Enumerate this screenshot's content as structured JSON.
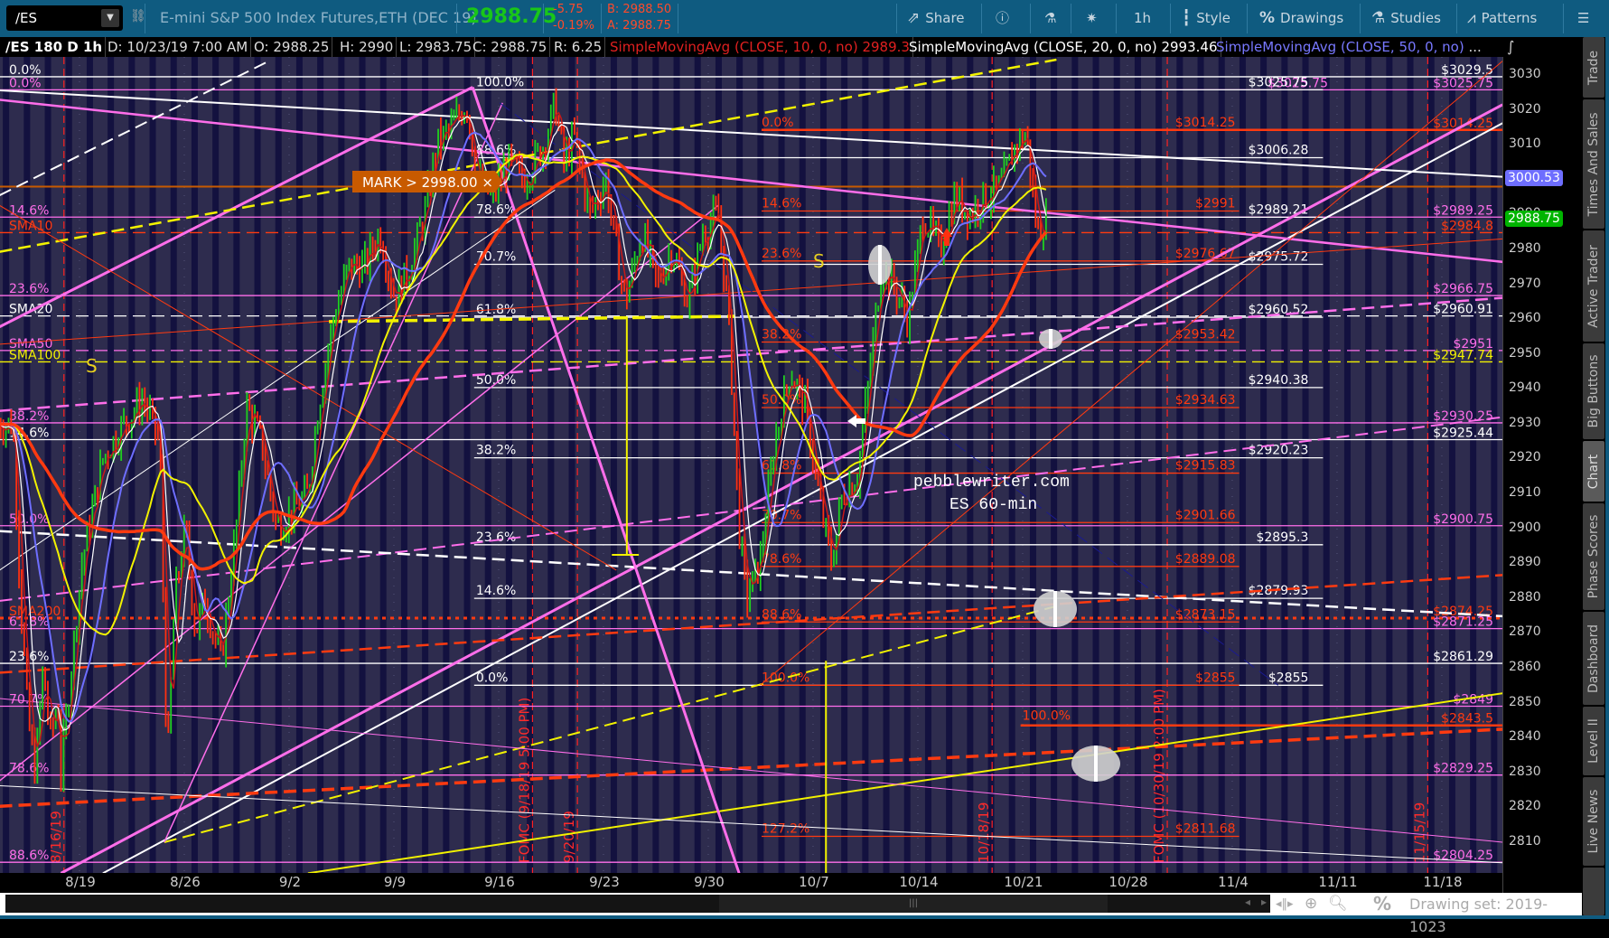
{
  "toolbar": {
    "symbol": "/ES",
    "description": "E-mini S&P 500 Index Futures,ETH (DEC 19)",
    "last_price": "2988.75",
    "net_change": "-5.75",
    "pct_change": "-0.19%",
    "bid": "B: 2988.50",
    "ask": "A: 2988.75",
    "buttons": {
      "share": "Share",
      "timeframe": "1h",
      "style": "Style",
      "drawings": "Drawings",
      "studies": "Studies",
      "patterns": "Patterns"
    },
    "colors": {
      "bg": "#0f5b80",
      "up": "#19c619",
      "down": "#ff4a2a"
    }
  },
  "info_row": {
    "title": "/ES 180 D 1h",
    "date": "D: 10/23/19 7:00 AM",
    "open": "O: 2988.25",
    "high": "H: 2990",
    "low": "L: 2983.75",
    "close": "C: 2988.75",
    "range": "R: 6.25",
    "studies": [
      {
        "label": "SimpleMovingAvg (CLOSE, 10, 0, no)",
        "value": "2989.3",
        "color": "#e02020"
      },
      {
        "label": "SimpleMovingAvg (CLOSE, 20, 0, no)",
        "value": "2993.46",
        "color": "#ffffff"
      },
      {
        "label": "SimpleMovingAvg (CLOSE, 50, 0, no)",
        "value": "...",
        "color": "#7878ff"
      }
    ]
  },
  "chart_data": {
    "type": "candlestick",
    "symbol": "/ES",
    "interval": "1h",
    "ylim": [
      2801,
      3035
    ],
    "y_ticks": [
      3030,
      3020,
      3010,
      3000,
      2990,
      2980,
      2970,
      2960,
      2950,
      2940,
      2930,
      2920,
      2910,
      2900,
      2890,
      2880,
      2870,
      2860,
      2850,
      2840,
      2830,
      2820,
      2810
    ],
    "x_ticks": [
      "8/19",
      "8/26",
      "9/2",
      "9/9",
      "9/16",
      "9/23",
      "9/30",
      "10/7",
      "10/14",
      "10/21",
      "10/28",
      "11/4",
      "11/11",
      "11/18"
    ],
    "x_unit": "days from 8/19 (7 per week)",
    "price_path": [
      [
        -5.5,
        2930
      ],
      [
        -4.5,
        2930
      ],
      [
        -4,
        2880
      ],
      [
        -3.5,
        2845
      ],
      [
        -3,
        2830
      ],
      [
        -2.5,
        2860
      ],
      [
        -2,
        2840
      ],
      [
        -1.5,
        2850
      ],
      [
        -1.3,
        2830
      ],
      [
        0.1,
        2890
      ],
      [
        1.5,
        2920
      ],
      [
        2.9,
        2930
      ],
      [
        4.2,
        2937
      ],
      [
        5.3,
        2925
      ],
      [
        5.8,
        2830
      ],
      [
        6.3,
        2880
      ],
      [
        7,
        2900
      ],
      [
        7.7,
        2870
      ],
      [
        8.3,
        2880
      ],
      [
        9.4,
        2862
      ],
      [
        10.4,
        2900
      ],
      [
        11.1,
        2935
      ],
      [
        12.1,
        2925
      ],
      [
        13.1,
        2900
      ],
      [
        14.2,
        2905
      ],
      [
        15.2,
        2910
      ],
      [
        15.9,
        2935
      ],
      [
        16.9,
        2960
      ],
      [
        17.9,
        2975
      ],
      [
        19,
        2975
      ],
      [
        20,
        2985
      ],
      [
        21,
        2966
      ],
      [
        22,
        2975
      ],
      [
        23,
        2990
      ],
      [
        23.8,
        3010
      ],
      [
        24.8,
        3015
      ],
      [
        25.8,
        3022
      ],
      [
        26.5,
        3000
      ],
      [
        27.5,
        2995
      ],
      [
        28.6,
        3005
      ],
      [
        29.6,
        3000
      ],
      [
        31,
        3010
      ],
      [
        31.7,
        3022
      ],
      [
        32.3,
        3005
      ],
      [
        33,
        3012
      ],
      [
        34,
        2990
      ],
      [
        35.1,
        3000
      ],
      [
        35.8,
        2980
      ],
      [
        36.4,
        2965
      ],
      [
        37.5,
        2985
      ],
      [
        38.5,
        2970
      ],
      [
        39.5,
        2980
      ],
      [
        40.6,
        2965
      ],
      [
        41.6,
        2985
      ],
      [
        42.6,
        2990
      ],
      [
        43.3,
        2960
      ],
      [
        44,
        2900
      ],
      [
        44.5,
        2880
      ],
      [
        45.4,
        2890
      ],
      [
        46.4,
        2925
      ],
      [
        47.4,
        2945
      ],
      [
        48.4,
        2935
      ],
      [
        49.5,
        2905
      ],
      [
        50.2,
        2890
      ],
      [
        50.9,
        2910
      ],
      [
        51.9,
        2915
      ],
      [
        52.6,
        2940
      ],
      [
        53.5,
        2975
      ],
      [
        54.3,
        2970
      ],
      [
        55.3,
        2960
      ],
      [
        56.3,
        2990
      ],
      [
        57.4,
        2980
      ],
      [
        58.4,
        2995
      ],
      [
        59.4,
        2990
      ],
      [
        60.4,
        2995
      ],
      [
        61.5,
        2998
      ],
      [
        62.5,
        3010
      ],
      [
        63.2,
        3013
      ],
      [
        63.9,
        2985
      ],
      [
        64.6,
        2988.75
      ]
    ],
    "moving_averages": [
      {
        "name": "SMA10",
        "color": "#c81818"
      },
      {
        "name": "SMA20",
        "color": "#ffffff"
      },
      {
        "name": "SMA50",
        "color": "#6e6eff"
      },
      {
        "name": "SMA100",
        "color": "#f2f200"
      },
      {
        "name": "SMA200",
        "color": "#ff3a10"
      }
    ],
    "levels_full": [
      {
        "price": 3029.5,
        "color": "#ffffff",
        "style": "solid",
        "left": "0.0%",
        "right": "$3029.5"
      },
      {
        "price": 3025.75,
        "color": "#ff6eea",
        "style": "solid",
        "left": "0.0%",
        "right": "$3025.75"
      },
      {
        "price": 2989.25,
        "color": "#ff6eea",
        "style": "solid",
        "left": "14.6%",
        "right": "$2989.25"
      },
      {
        "price": 2984.8,
        "color": "#ff3a10",
        "style": "dash",
        "left": "SMA10",
        "right": "$2984.8"
      },
      {
        "price": 2966.75,
        "color": "#ff6eea",
        "style": "solid",
        "left": "23.6%",
        "right": "$2966.75"
      },
      {
        "price": 2960.91,
        "color": "#ffffff",
        "style": "dash",
        "left": "SMA20",
        "right": "$2960.91"
      },
      {
        "price": 2951,
        "color": "#ff6eea",
        "style": "dash",
        "left": "SMA50",
        "right": "$2951"
      },
      {
        "price": 2947.74,
        "color": "#f2f200",
        "style": "dash",
        "left": "SMA100",
        "right": "$2947.74"
      },
      {
        "price": 2930.25,
        "color": "#ff6eea",
        "style": "solid",
        "left": "38.2%",
        "right": "$2930.25"
      },
      {
        "price": 2925.44,
        "color": "#ffffff",
        "style": "solid",
        "left": "14.6%",
        "right": "$2925.44"
      },
      {
        "price": 2900.75,
        "color": "#ff6eea",
        "style": "solid",
        "left": "50.0%",
        "right": "$2900.75"
      },
      {
        "price": 2874.25,
        "color": "#ff3a10",
        "style": "dot",
        "left": "SMA200",
        "right": "$2874.25"
      },
      {
        "price": 2871.25,
        "color": "#ff6eea",
        "style": "solid",
        "left": "61.8%",
        "right": "$2871.25"
      },
      {
        "price": 2861.29,
        "color": "#ffffff",
        "style": "solid",
        "left": "23.6%",
        "right": "$2861.29"
      },
      {
        "price": 2849,
        "color": "#ff6eea",
        "style": "solid",
        "left": "70.7%",
        "right": "$2849"
      },
      {
        "price": 2829.25,
        "color": "#ff6eea",
        "style": "solid",
        "left": "78.6%",
        "right": "$2829.25"
      },
      {
        "price": 2804.25,
        "color": "#ff6eea",
        "style": "solid",
        "left": "88.6%",
        "right": "$2804.25"
      }
    ],
    "extra_pink_label": "$3025.75",
    "fib_white": {
      "t_start": 26.3,
      "t_end": 83,
      "color": "#ffffff",
      "levels": [
        {
          "price": 3025.75,
          "pct": "100.0%",
          "value": "$3025.75"
        },
        {
          "price": 3006.28,
          "pct": "88.6%",
          "value": "$3006.28"
        },
        {
          "price": 2989.21,
          "pct": "78.6%",
          "value": "$2989.21"
        },
        {
          "price": 2975.72,
          "pct": "70.7%",
          "value": "$2975.72"
        },
        {
          "price": 2960.52,
          "pct": "61.8%",
          "value": "$2960.52"
        },
        {
          "price": 2940.38,
          "pct": "50.0%",
          "value": "$2940.38"
        },
        {
          "price": 2920.23,
          "pct": "38.2%",
          "value": "$2920.23"
        },
        {
          "price": 2895.3,
          "pct": "23.6%",
          "value": "$2895.3"
        },
        {
          "price": 2879.93,
          "pct": "14.6%",
          "value": "$2879.93"
        },
        {
          "price": 2855,
          "pct": "0.0%",
          "value": "$2855"
        }
      ]
    },
    "fib_red": {
      "t_start": 45.5,
      "t_end": 77.4,
      "color": "#ff3a10",
      "levels": [
        {
          "price": 3014.25,
          "pct": "0.0%",
          "value": "$3014.25",
          "full": true,
          "right": "$3014.25"
        },
        {
          "price": 2991,
          "pct": "14.6%",
          "value": "$2991"
        },
        {
          "price": 2976.67,
          "pct": "23.6%",
          "value": "$2976.67"
        },
        {
          "price": 2953.42,
          "pct": "38.2%",
          "value": "$2953.42"
        },
        {
          "price": 2934.63,
          "pct": "50.0%",
          "value": "$2934.63"
        },
        {
          "price": 2915.83,
          "pct": "61.8%",
          "value": "$2915.83"
        },
        {
          "price": 2901.66,
          "pct": "70.7%",
          "value": "$2901.66"
        },
        {
          "price": 2889.08,
          "pct": "78.6%",
          "value": "$2889.08"
        },
        {
          "price": 2873.15,
          "pct": "88.6%",
          "value": "$2873.15"
        },
        {
          "price": 2855,
          "pct": "100.0%",
          "value": "$2855"
        },
        {
          "price": 2811.68,
          "pct": "127.2%",
          "value": "$2811.68"
        }
      ]
    },
    "level_2843": {
      "price": 2843.5,
      "t_start": 62.8,
      "pct": "100.0%",
      "right": "$2843.5",
      "color": "#ff3a10"
    },
    "trendlines": [
      [
        -5.4,
        2957.8,
        26.2,
        3026.5,
        "#ff6eea",
        "solid",
        3
      ],
      [
        -1.3,
        2801.1,
        95,
        3021.5,
        "#ff6eea",
        "solid",
        3
      ],
      [
        1.5,
        2801.1,
        95,
        3016.2,
        "#ffffff",
        "solid",
        2
      ],
      [
        -5.4,
        3025.6,
        95,
        3000.8,
        "#ffffff",
        "solid",
        2
      ],
      [
        -5.4,
        3022.9,
        95,
        2976.4,
        "#ff6eea",
        "solid",
        2.5
      ],
      [
        -5.4,
        2979.3,
        65.2,
        3034.4,
        "#f2f200",
        "dash",
        2.5
      ],
      [
        -5.4,
        2995.5,
        12.5,
        3033.8,
        "#ffffff",
        "dash",
        2
      ],
      [
        -5.4,
        2933.7,
        95,
        2966.1,
        "#ff6eea",
        "dash",
        2.5
      ],
      [
        -5.4,
        2879.2,
        95,
        2931.9,
        "#ff6eea",
        "dash",
        2
      ],
      [
        -5.4,
        2899.2,
        95,
        2874.8,
        "#ffffff",
        "dash",
        2.5
      ],
      [
        -5.4,
        2820.3,
        95,
        2842.4,
        "#ff3a10",
        "dash",
        3.5
      ],
      [
        -5.4,
        2858.6,
        95,
        2886.6,
        "#ff3a10",
        "dash",
        2.5
      ],
      [
        15.2,
        2801.1,
        95,
        2852.7,
        "#f2f200",
        "solid",
        2
      ],
      [
        5.6,
        2810,
        65.2,
        2877.7,
        "#f2f200",
        "dash",
        2
      ],
      [
        26.2,
        3026.5,
        44,
        2801.1,
        "#ff6eea",
        "solid",
        3
      ],
      [
        -5.4,
        2826.2,
        95,
        2804.1,
        "#ffffff",
        "solid",
        1
      ],
      [
        -5.4,
        2851.2,
        95,
        2810,
        "#ff6eea",
        "solid",
        1
      ],
      [
        -5.4,
        2888,
        31.7,
        2997,
        "#ffffff",
        "solid",
        1
      ],
      [
        5.6,
        2810,
        28.2,
        3022,
        "#ff6eea",
        "solid",
        1.5
      ],
      [
        -5.4,
        2827.6,
        42.6,
        2992.6,
        "#ff6eea",
        "solid",
        1.5
      ],
      [
        -5.4,
        2992.6,
        35.8,
        2888,
        "#ff3a10",
        "solid",
        1
      ],
      [
        -5.4,
        2952.8,
        95,
        2983,
        "#ff3a10",
        "solid",
        1
      ],
      [
        45.4,
        2855,
        95,
        3034,
        "#ff3a10",
        "solid",
        1
      ],
      [
        28,
        3022,
        80,
        2855,
        "#1a1a90",
        "dash",
        1
      ],
      [
        16.6,
        2959.3,
        43.7,
        2960.8,
        "#f2f200",
        "dash",
        3.5
      ]
    ],
    "mark_line": {
      "price": 2998,
      "label": "MARK > 2998.00 ×",
      "color": "#c85a00"
    },
    "current_price_badge": {
      "price": 2988.75,
      "label": "2988.75",
      "color": "#00b400"
    },
    "sma_badge": {
      "price": 3000.53,
      "label": "3000.53",
      "color": "#6e6eff"
    },
    "event_lines": [
      {
        "t": -1.1,
        "label": "8/16/19"
      },
      {
        "t": 30.2,
        "label": "FOMC (9/18/19 5:00 PM)"
      },
      {
        "t": 33.2,
        "label": "9/20/19"
      },
      {
        "t": 60.9,
        "label": "10/18/19"
      },
      {
        "t": 72.6,
        "label": "FOMC (10/30/19 2:00 PM)"
      },
      {
        "t": 90,
        "label": "11/15/19"
      }
    ],
    "annotations": {
      "site": "pebblewriter.com",
      "subtitle": "ES 60-min",
      "s1": "S",
      "s2": "S"
    }
  },
  "sidebar": {
    "tabs": [
      "Trade",
      "Times And Sales",
      "Active Trader",
      "Big Buttons",
      "Chart",
      "Phase Scores",
      "Dashboard",
      "Level II",
      "Live News"
    ],
    "selected": "Chart"
  },
  "bottombar": {
    "drawing_set": "Drawing set: 2019-1023",
    "scroll_grip": "|||"
  }
}
